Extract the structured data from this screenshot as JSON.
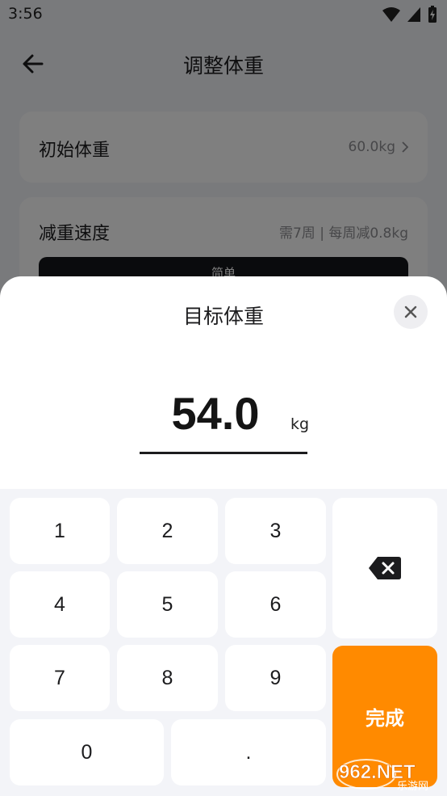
{
  "status_bar": {
    "time": "3:56"
  },
  "header": {
    "title": "调整体重"
  },
  "initial_weight": {
    "label": "初始体重",
    "value": "60.0kg"
  },
  "weight_loss_speed": {
    "label": "减重速度",
    "value": "需7周 | 每周减0.8kg",
    "mode_label": "简单"
  },
  "sheet": {
    "title": "目标体重",
    "value": "54.0",
    "unit": "kg"
  },
  "keypad": {
    "keys": [
      "1",
      "2",
      "3",
      "4",
      "5",
      "6",
      "7",
      "8",
      "9",
      "0",
      "."
    ],
    "done_label": "完成"
  },
  "watermark": {
    "main": "962.NET",
    "sub": "乐游网"
  },
  "colors": {
    "accent": "#ff8a00",
    "background": "#f3f4f8",
    "text": "#1c1c1e",
    "muted": "#8e8e93"
  }
}
